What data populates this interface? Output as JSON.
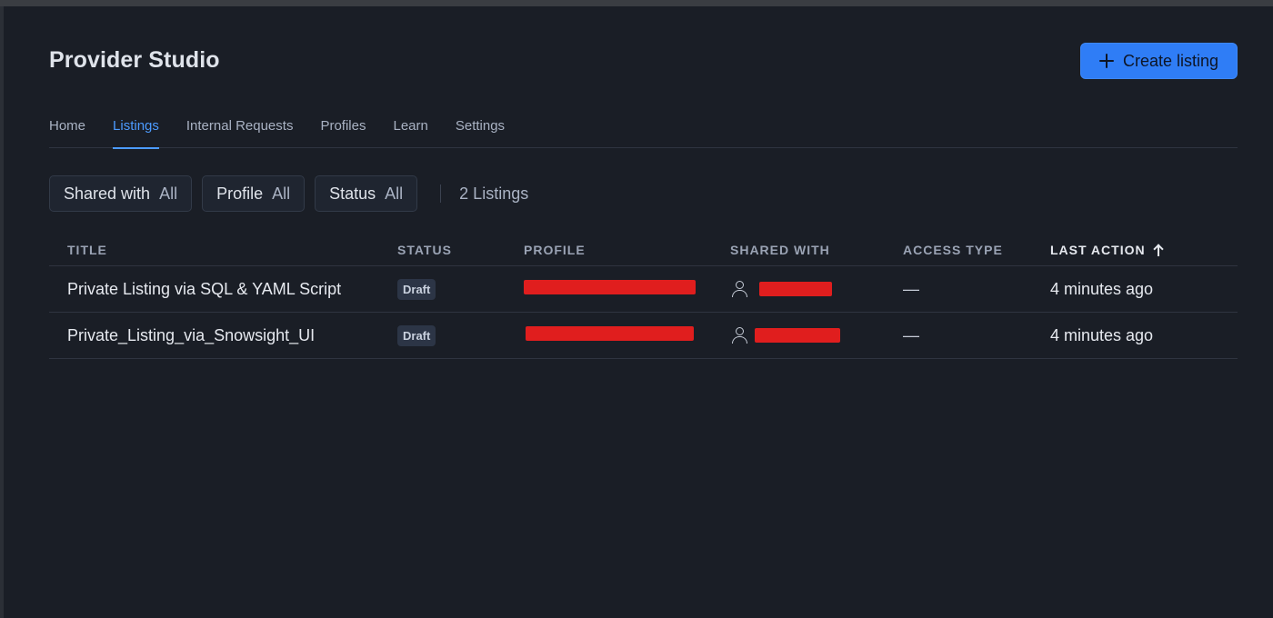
{
  "header": {
    "title": "Provider Studio",
    "create_label": "Create listing"
  },
  "tabs": [
    {
      "label": "Home"
    },
    {
      "label": "Listings",
      "active": true
    },
    {
      "label": "Internal Requests"
    },
    {
      "label": "Profiles"
    },
    {
      "label": "Learn"
    },
    {
      "label": "Settings"
    }
  ],
  "filters": [
    {
      "label": "Shared with",
      "value": "All"
    },
    {
      "label": "Profile",
      "value": "All"
    },
    {
      "label": "Status",
      "value": "All"
    }
  ],
  "listing_count": "2 Listings",
  "table": {
    "columns": [
      "TITLE",
      "STATUS",
      "PROFILE",
      "SHARED WITH",
      "ACCESS TYPE",
      "LAST ACTION"
    ],
    "sorted_column": "LAST ACTION",
    "rows": [
      {
        "title": "Private Listing via SQL & YAML Script",
        "status": "Draft",
        "access_type": "—",
        "last_action": "4 minutes ago"
      },
      {
        "title": "Private_Listing_via_Snowsight_UI",
        "status": "Draft",
        "access_type": "—",
        "last_action": "4 minutes ago"
      }
    ]
  },
  "colors": {
    "background": "#1a1e26",
    "accent": "#2f7df6",
    "active_tab": "#4c9bff",
    "redaction": "#e01e1e"
  }
}
